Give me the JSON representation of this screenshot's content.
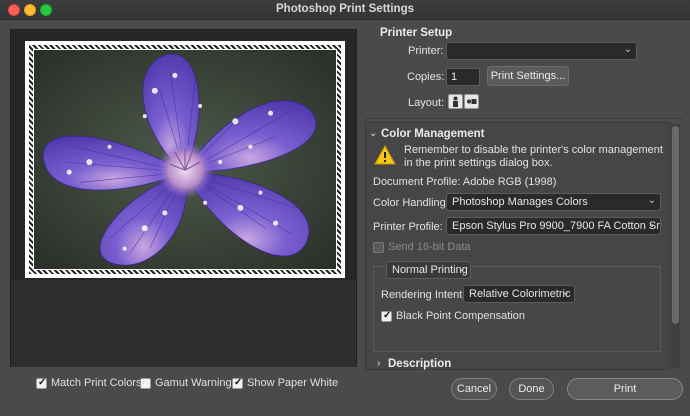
{
  "window": {
    "title": "Photoshop Print Settings"
  },
  "printer_setup": {
    "heading": "Printer Setup",
    "printer_label": "Printer:",
    "printer_value": "",
    "copies_label": "Copies:",
    "copies_value": "1",
    "print_settings_label": "Print Settings...",
    "layout_label": "Layout:"
  },
  "color_management": {
    "heading": "Color Management",
    "warning": "Remember to disable the printer's color management in the print settings dialog box.",
    "document_profile": "Document Profile: Adobe RGB (1998)",
    "color_handling_label": "Color Handling:",
    "color_handling_value": "Photoshop Manages Colors",
    "printer_profile_label": "Printer Profile:",
    "printer_profile_value": "Epson Stylus Pro 9900_7900 FA Cotton Smo...",
    "send16_label": "Send 16-bit Data",
    "printing_mode": "Normal Printing",
    "rendering_intent_label": "Rendering Intent:",
    "rendering_intent_value": "Relative Colorimetric",
    "black_point_label": "Black Point Compensation"
  },
  "description": {
    "heading": "Description"
  },
  "preview_options": {
    "match_print_colors": "Match Print Colors",
    "gamut_warning": "Gamut Warning",
    "show_paper_white": "Show Paper White"
  },
  "actions": {
    "cancel": "Cancel",
    "done": "Done",
    "print": "Print"
  },
  "icons": {
    "warning": "warning-triangle-icon",
    "disclosure_open": "chevron-down-icon",
    "disclosure_closed": "chevron-right-icon",
    "layout_portrait": "portrait-layout-icon",
    "layout_landscape": "landscape-layout-icon"
  },
  "colors": {
    "accent_warning": "#f5c518",
    "flower": "#6b52c8",
    "background": "#4a4a4a"
  }
}
